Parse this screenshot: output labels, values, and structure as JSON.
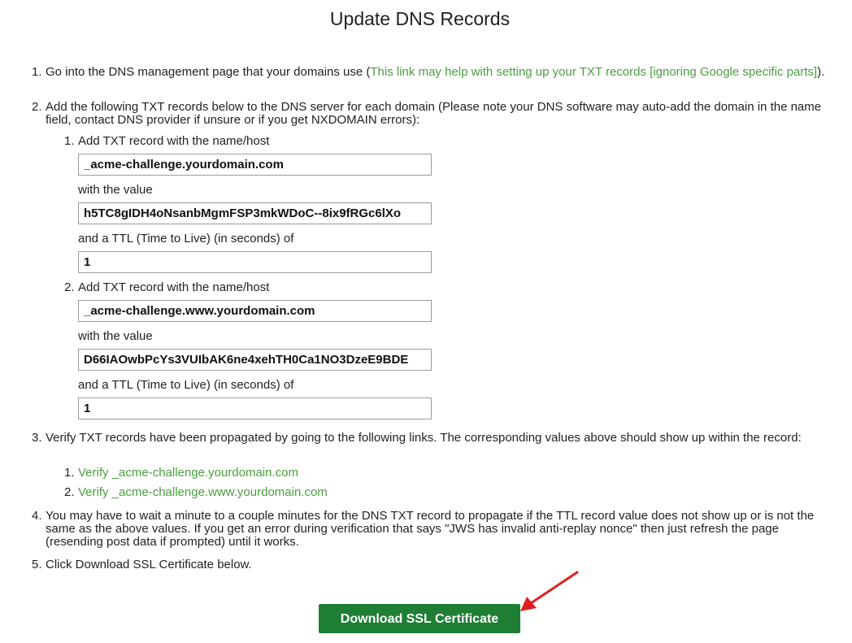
{
  "title": "Update DNS Records",
  "steps": {
    "s1": {
      "num": "1.",
      "text": "Go into the DNS management page that your domains use (",
      "link": "This link may help with setting up your TXT records [ignoring Google specific parts]",
      "after": ")."
    },
    "s2": {
      "num": "2.",
      "text": "Add the following TXT records below to the DNS server for each domain (Please note your DNS software may auto-add the domain in the name field, contact DNS provider if unsure or if you get NXDOMAIN errors):"
    },
    "s3": {
      "num": "3.",
      "text": "Verify TXT records have been propagated by going to the following links. The corresponding values above should show up within the record:"
    },
    "s4": {
      "num": "4.",
      "text": "You may have to wait a minute to a couple minutes for the DNS TXT record to propagate if the TTL record value does not show up or is not the same as the above values. If you get an error during verification that says \"JWS has invalid anti-replay nonce\" then just refresh the page (resending post data if prompted) until it works."
    },
    "s5": {
      "num": "5.",
      "text": "Click Download SSL Certificate below."
    }
  },
  "records": [
    {
      "num": "1.",
      "name_label": "Add TXT record with the name/host",
      "name": "_acme-challenge.yourdomain.com",
      "value_label": "with the value",
      "value": "h5TC8gIDH4oNsanbMgmFSP3mkWDoC--8ix9fRGc6lXo",
      "ttl_label": "and a TTL (Time to Live) (in seconds) of",
      "ttl": "1"
    },
    {
      "num": "2.",
      "name_label": "Add TXT record with the name/host",
      "name": "_acme-challenge.www.yourdomain.com",
      "value_label": "with the value",
      "value": "D66IAOwbPcYs3VUIbAK6ne4xehTH0Ca1NO3DzeE9BDE",
      "ttl_label": "and a TTL (Time to Live) (in seconds) of",
      "ttl": "1"
    }
  ],
  "verify_links": [
    {
      "num": "1.",
      "label": "Verify _acme-challenge.yourdomain.com"
    },
    {
      "num": "2.",
      "label": "Verify _acme-challenge.www.yourdomain.com"
    }
  ],
  "download_button": "Download SSL Certificate",
  "colors": {
    "link": "#4a9e3f",
    "button": "#1e7e34",
    "arrow": "#e02020"
  }
}
